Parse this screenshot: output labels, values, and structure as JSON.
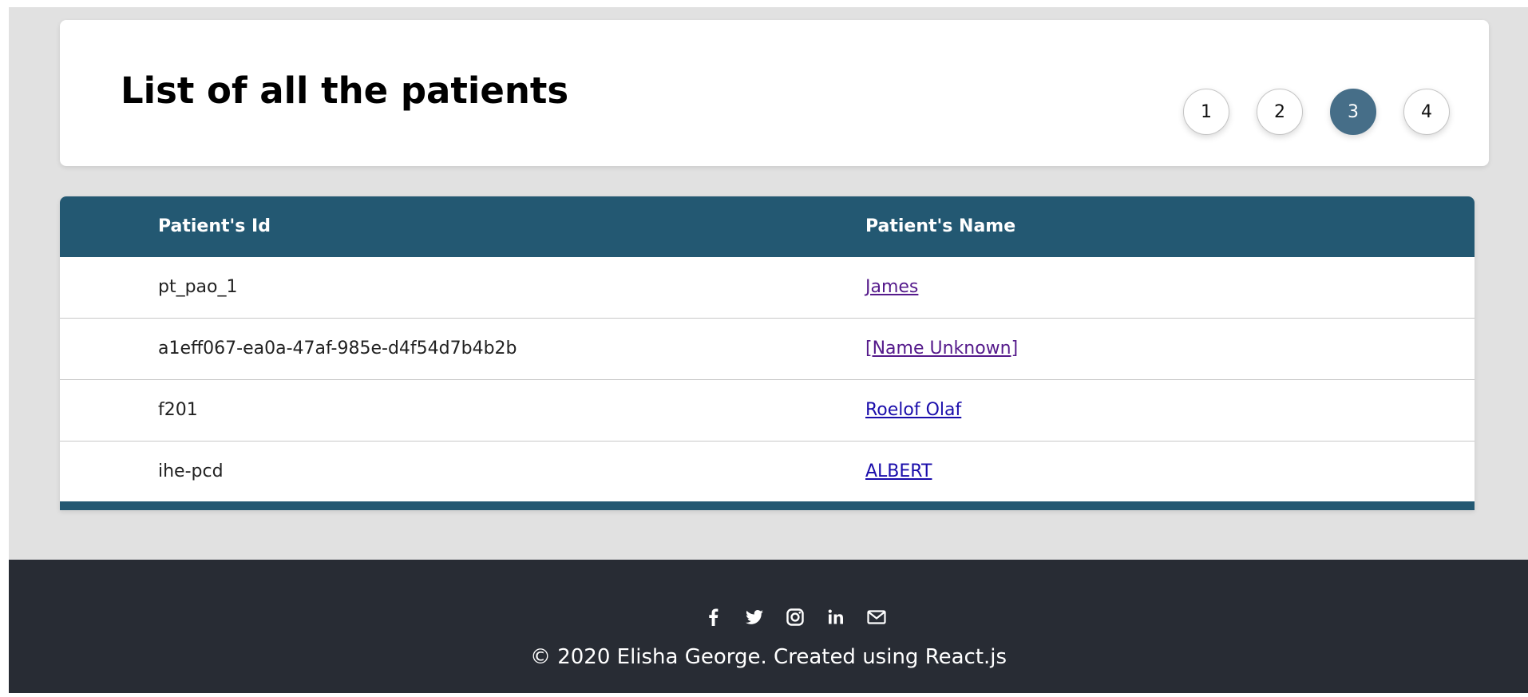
{
  "header": {
    "title": "List of all the patients"
  },
  "pagination": {
    "pages": [
      "1",
      "2",
      "3",
      "4"
    ],
    "current": "3"
  },
  "table": {
    "columns": [
      "Patient's Id",
      "Patient's Name"
    ],
    "rows": [
      {
        "id": "pt_pao_1",
        "name": "James"
      },
      {
        "id": "a1eff067-ea0a-47af-985e-d4f54d7b4b2b",
        "name": "[Name Unknown]"
      },
      {
        "id": "f201",
        "name": "Roelof Olaf"
      },
      {
        "id": "ihe-pcd",
        "name": "ALBERT"
      }
    ]
  },
  "footer": {
    "social_icons": [
      "facebook-icon",
      "twitter-icon",
      "instagram-icon",
      "linkedin-icon",
      "mail-icon"
    ],
    "copyright": "© 2020 Elisha George. Created using React.js"
  },
  "colors": {
    "accent": "#235872",
    "active_page": "#466e88",
    "footer_bg": "#282c34",
    "page_bg": "#e1e1e1",
    "link": "#1a0dab",
    "visited_link": "#551a8b"
  }
}
